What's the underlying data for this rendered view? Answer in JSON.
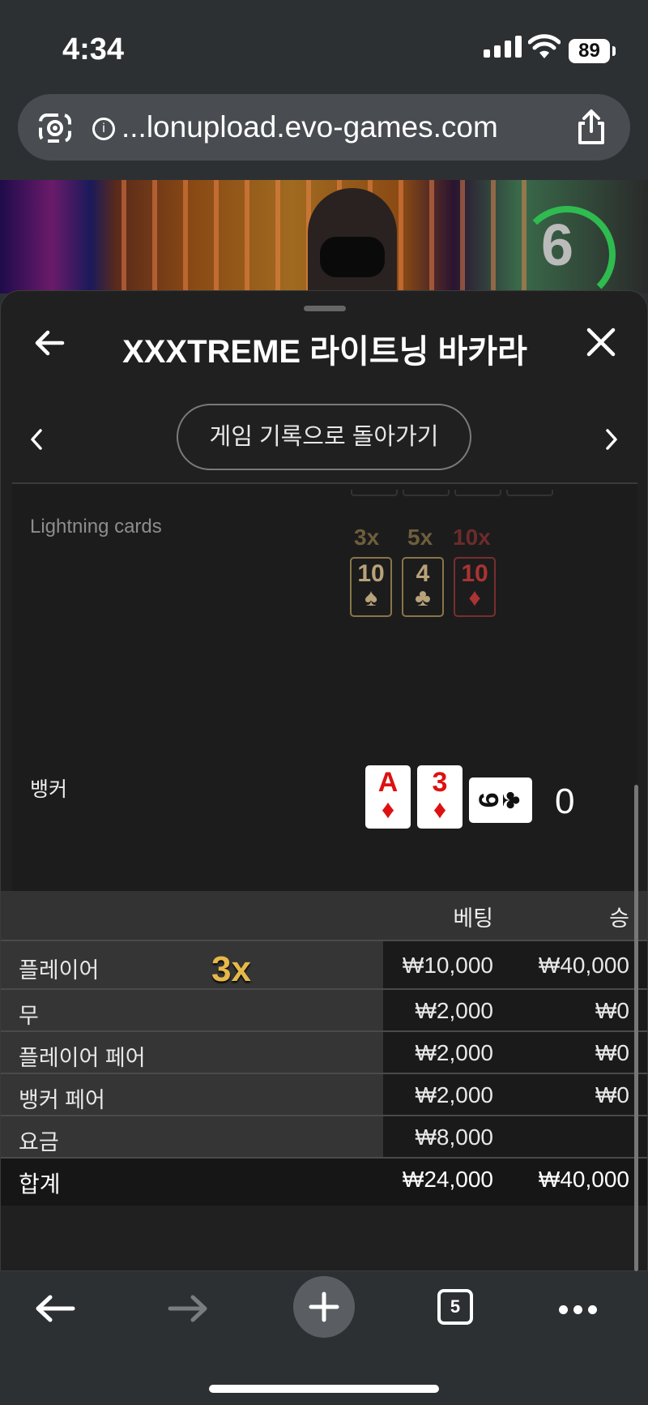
{
  "status_bar": {
    "time": "4:34",
    "battery": "89"
  },
  "browser": {
    "url": "...lonupload.evo-games.com",
    "tab_count": "5"
  },
  "video": {
    "timer": "6"
  },
  "panel": {
    "title": "XXXTREME 라이트닝 바카라",
    "back_to_history": "게임 기록으로 돌아가기",
    "lightning_cards_label": "Lightning cards",
    "lightning_cards": [
      {
        "multiplier": "3x",
        "rank": "10",
        "suit": "♠",
        "color": "#b89a5a"
      },
      {
        "multiplier": "5x",
        "rank": "4",
        "suit": "♣",
        "color": "#b89a5a"
      },
      {
        "multiplier": "10x",
        "rank": "10",
        "suit": "♦",
        "color": "#c0392b"
      }
    ],
    "banker_label": "뱅커",
    "banker_cards": [
      {
        "rank": "A",
        "suit": "♦"
      },
      {
        "rank": "3",
        "suit": "♦"
      },
      {
        "rank": "9",
        "suit": "♣"
      }
    ],
    "banker_score": "0"
  },
  "bets_table": {
    "col_bet": "베팅",
    "col_win": "승",
    "rows": [
      {
        "label": "플레이어",
        "multiplier": "3x",
        "bet": "₩10,000",
        "win": "₩40,000"
      },
      {
        "label": "무",
        "bet": "₩2,000",
        "win": "₩0"
      },
      {
        "label": "플레이어 페어",
        "bet": "₩2,000",
        "win": "₩0"
      },
      {
        "label": "뱅커 페어",
        "bet": "₩2,000",
        "win": "₩0"
      },
      {
        "label": "요금",
        "bet": "₩8,000",
        "win": ""
      }
    ],
    "total": {
      "label": "합계",
      "bet": "₩24,000",
      "win": "₩40,000"
    }
  }
}
